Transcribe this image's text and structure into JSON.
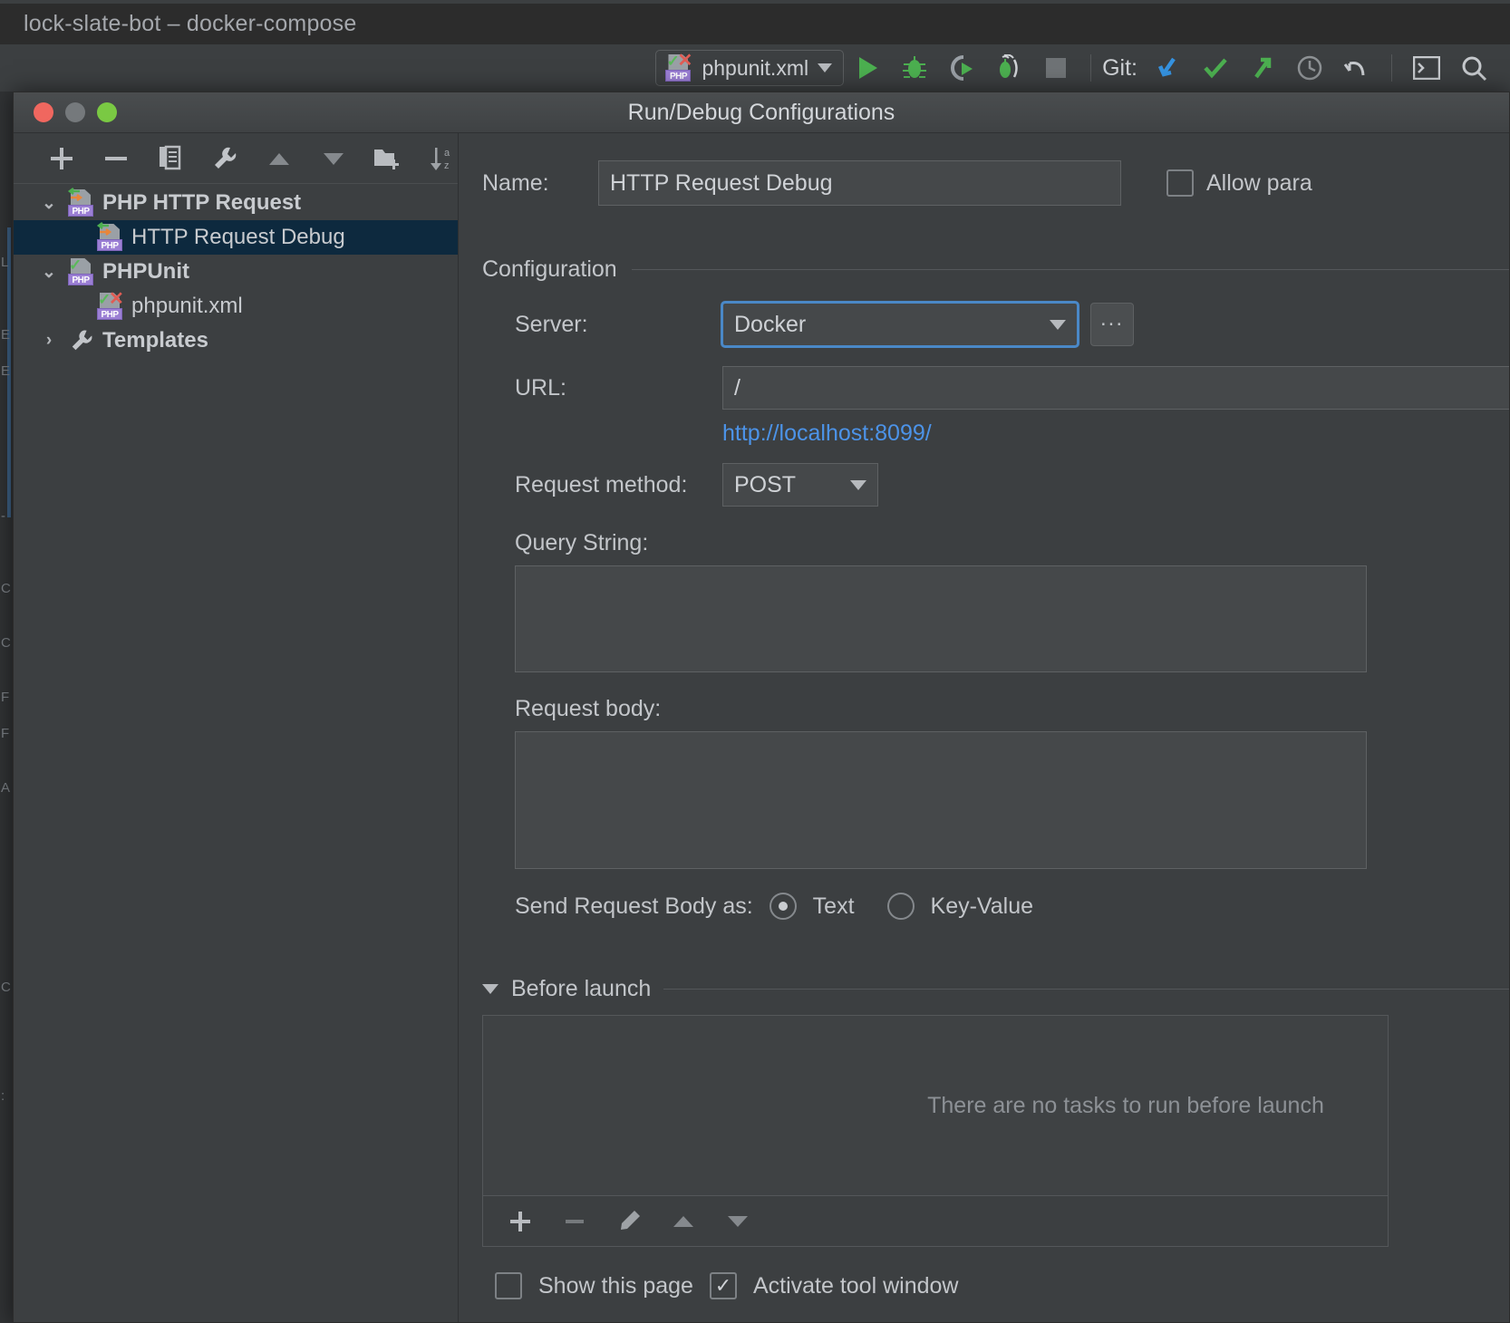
{
  "ide": {
    "window_title": "lock-slate-bot – docker-compose",
    "run_config_chip": {
      "label": "phpunit.xml",
      "icon": "php-test-file-icon"
    },
    "toolbar_icons": [
      "run-icon",
      "debug-icon",
      "run-with-coverage-icon",
      "profile-icon",
      "stop-icon"
    ],
    "git_label": "Git:",
    "git_icons": [
      "update-project-icon",
      "commit-icon",
      "push-icon",
      "history-icon",
      "rollback-icon"
    ],
    "right_icons": [
      "terminal-icon",
      "search-everywhere-icon"
    ]
  },
  "dialog": {
    "title": "Run/Debug Configurations",
    "traffic_lights": [
      "close-button",
      "minimize-button",
      "zoom-button"
    ],
    "tree_toolbar": [
      {
        "name": "add-configuration-button",
        "glyph": "+"
      },
      {
        "name": "remove-configuration-button",
        "glyph": "−"
      },
      {
        "name": "copy-configuration-button",
        "glyph": "copy-icon"
      },
      {
        "name": "edit-templates-button",
        "glyph": "wrench-icon"
      },
      {
        "name": "move-up-button",
        "glyph": "triangle-up-icon"
      },
      {
        "name": "move-down-button",
        "glyph": "triangle-down-icon"
      },
      {
        "name": "create-folder-button",
        "glyph": "new-folder-icon"
      },
      {
        "name": "sort-configurations-button",
        "glyph": "sort-az-icon"
      }
    ],
    "tree": [
      {
        "label": "PHP HTTP Request",
        "type": "group",
        "expanded": true,
        "icon": "php-http-request-icon",
        "selected": false
      },
      {
        "label": "HTTP Request Debug",
        "type": "child",
        "icon": "php-http-request-icon",
        "selected": true
      },
      {
        "label": "PHPUnit",
        "type": "group",
        "expanded": true,
        "icon": "phpunit-icon",
        "selected": false
      },
      {
        "label": "phpunit.xml",
        "type": "child",
        "icon": "php-test-file-icon",
        "selected": false
      },
      {
        "label": "Templates",
        "type": "group",
        "expanded": false,
        "icon": "wrench-icon",
        "selected": false
      }
    ],
    "name": {
      "label": "Name:",
      "value": "HTTP Request Debug"
    },
    "allow_parallel": {
      "label": "Allow para",
      "checked": false
    },
    "configuration": {
      "section_title": "Configuration",
      "server": {
        "label": "Server:",
        "value": "Docker",
        "browse_label": "...",
        "focused": true
      },
      "url": {
        "label": "URL:",
        "value": "/",
        "hint": "http://localhost:8099/"
      },
      "request_method": {
        "label": "Request method:",
        "value": "POST"
      },
      "query_string": {
        "label": "Query String:",
        "value": ""
      },
      "request_body": {
        "label": "Request body:",
        "value": ""
      },
      "send_body_as": {
        "label": "Send Request Body as:",
        "options": [
          "Text",
          "Key-Value"
        ],
        "selected": "Text"
      }
    },
    "before_launch": {
      "section_title": "Before launch",
      "expanded": true,
      "empty_message": "There are no tasks to run before launch",
      "toolbar": [
        {
          "name": "add-task-button",
          "glyph": "+"
        },
        {
          "name": "remove-task-button",
          "glyph": "−"
        },
        {
          "name": "edit-task-button",
          "glyph": "pencil-icon"
        },
        {
          "name": "move-task-up-button",
          "glyph": "triangle-up-icon"
        },
        {
          "name": "move-task-down-button",
          "glyph": "triangle-down-icon"
        }
      ]
    },
    "footer": {
      "show_page": {
        "label": "Show this page",
        "checked": false
      },
      "activate_tool_window": {
        "label": "Activate tool window",
        "checked": true
      }
    }
  },
  "colors": {
    "accent_blue": "#4a88c7",
    "link_blue": "#4c93e8",
    "selection_blue": "#0d293e",
    "panel_bg": "#3c3f41",
    "field_bg": "#45484a",
    "text": "#c3c6ca"
  }
}
